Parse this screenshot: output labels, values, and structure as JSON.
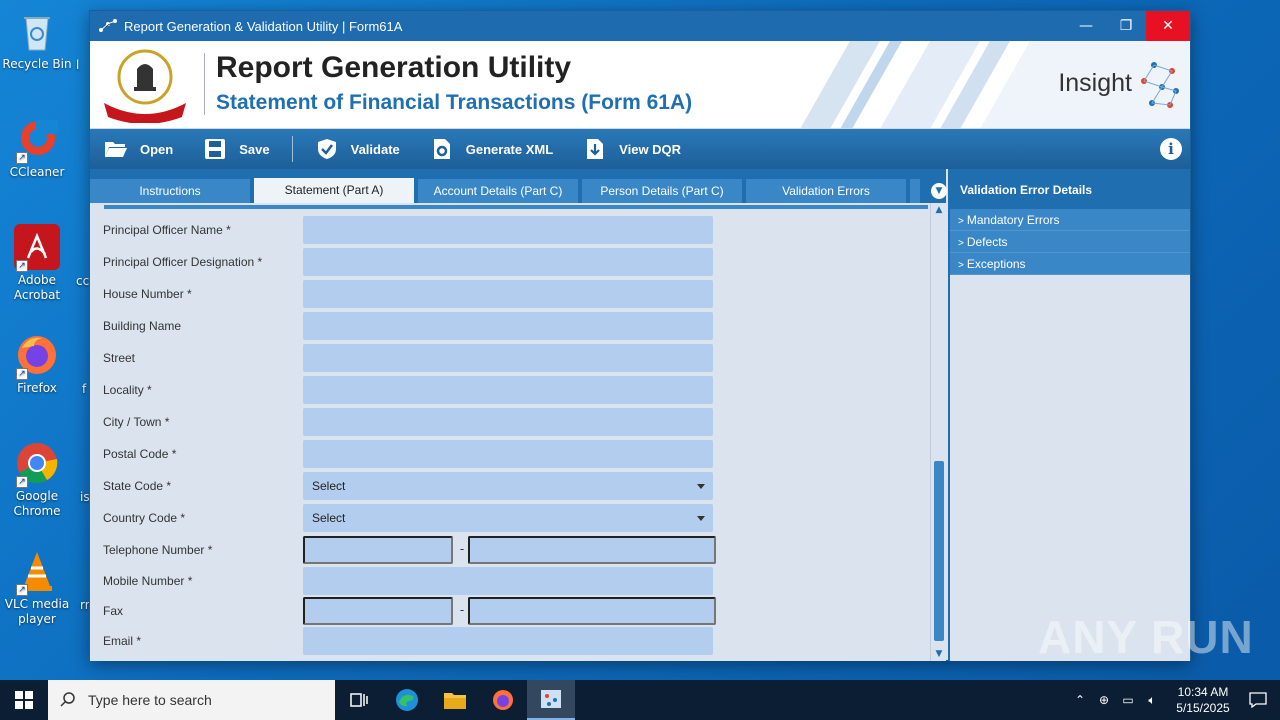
{
  "desktop": {
    "icons": [
      {
        "label": "Recycle Bin"
      },
      {
        "label": "CCleaner"
      },
      {
        "label": "Adobe Acrobat"
      },
      {
        "label": "Firefox"
      },
      {
        "label": "Google Chrome"
      },
      {
        "label": "VLC media player"
      }
    ],
    "partial_labels": [
      "l",
      "cc",
      "f",
      "is",
      "rr"
    ]
  },
  "window": {
    "title": "Report Generation & Validation Utility | Form61A",
    "controls": {
      "minimize": "—",
      "restore": "❐",
      "close": "✕"
    }
  },
  "banner": {
    "title": "Report Generation Utility",
    "subtitle": "Statement of Financial Transactions (Form 61A)",
    "brand": "Insight",
    "emblem_text": "INCOME TAX DEPARTMENT"
  },
  "toolbar": {
    "open": "Open",
    "save": "Save",
    "validate": "Validate",
    "generate_xml": "Generate XML",
    "view_dqr": "View DQR"
  },
  "tabs": [
    {
      "label": "Instructions",
      "active": false
    },
    {
      "label": "Statement (Part A)",
      "active": true
    },
    {
      "label": "Account Details (Part C)",
      "active": false
    },
    {
      "label": "Person Details (Part C)",
      "active": false
    },
    {
      "label": "Validation Errors",
      "active": false
    }
  ],
  "form": {
    "principal_officer_name": "Principal Officer Name *",
    "principal_officer_designation": "Principal Officer Designation *",
    "house_number": "House Number *",
    "building_name": "Building Name",
    "street": "Street",
    "locality": "Locality *",
    "city_town": "City / Town *",
    "postal_code": "Postal Code *",
    "state_code": "State Code *",
    "state_code_value": "Select",
    "country_code": "Country Code *",
    "country_code_value": "Select",
    "telephone_number": "Telephone Number *",
    "mobile_number": "Mobile Number *",
    "fax": "Fax",
    "email": "Email *",
    "separator": "-"
  },
  "right_panel": {
    "header": "Validation Error Details",
    "items": [
      "Mandatory Errors",
      "Defects",
      "Exceptions"
    ]
  },
  "watermark": "ANY RUN",
  "taskbar": {
    "search_placeholder": "Type here to search",
    "time": "10:34 AM",
    "date": "5/15/2025"
  }
}
